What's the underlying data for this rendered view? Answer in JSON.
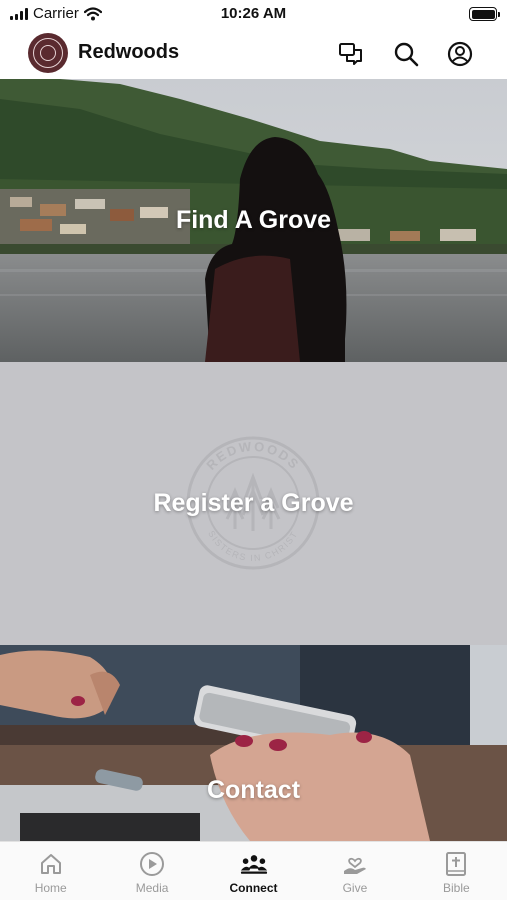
{
  "status_bar": {
    "carrier": "Carrier",
    "time": "10:26 AM"
  },
  "header": {
    "title": "Redwoods",
    "icons": [
      "chat-icon",
      "search-icon",
      "profile-icon"
    ]
  },
  "tiles": [
    {
      "label": "Find A Grove"
    },
    {
      "label": "Register a Grove",
      "watermark": [
        "REDWOODS",
        "SISTERS IN CHRIST"
      ]
    },
    {
      "label": "Contact"
    }
  ],
  "tabs": [
    {
      "label": "Home",
      "icon": "home-icon",
      "active": false
    },
    {
      "label": "Media",
      "icon": "play-icon",
      "active": false
    },
    {
      "label": "Connect",
      "icon": "people-icon",
      "active": true
    },
    {
      "label": "Give",
      "icon": "give-icon",
      "active": false
    },
    {
      "label": "Bible",
      "icon": "bible-icon",
      "active": false
    }
  ],
  "colors": {
    "brand": "#5a2a2f",
    "register_tile_bg": "#c4c4c8",
    "tab_active": "#111111",
    "tab_inactive": "#9a9a9a"
  }
}
